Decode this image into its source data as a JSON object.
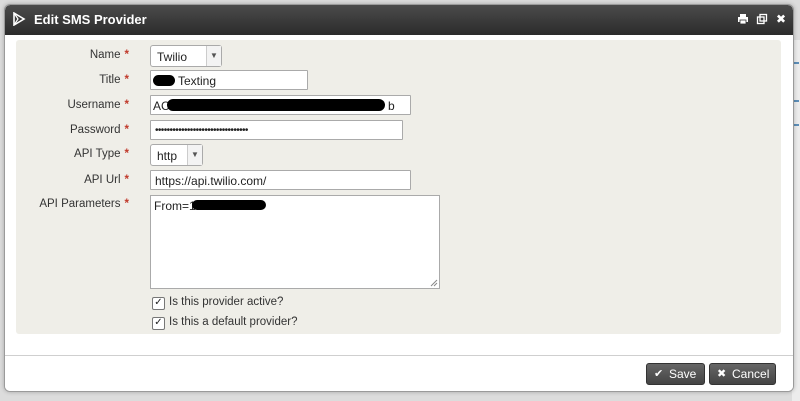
{
  "dialog": {
    "title": "Edit SMS Provider",
    "controls": {
      "print_icon": "printer-icon",
      "restore_icon": "restore-icon",
      "close_icon": "close-icon",
      "close_glyph": "✖"
    }
  },
  "form": {
    "required_mark": "*",
    "name": {
      "label": "Name",
      "value": "Twilio"
    },
    "title_field": {
      "label": "Title",
      "value": "Texting"
    },
    "username": {
      "label": "Username",
      "value_prefix": "AC",
      "value_suffix": "b"
    },
    "password": {
      "label": "Password",
      "value": "••••••••••••••••••••••••••••••••"
    },
    "api_type": {
      "label": "API Type",
      "value": "http"
    },
    "api_url": {
      "label": "API Url",
      "value": "https://api.twilio.com/"
    },
    "api_parameters": {
      "label": "API Parameters",
      "value_prefix": "From=1"
    },
    "active": {
      "label": "Is this provider active?",
      "checked": true
    },
    "default": {
      "label": "Is this a default provider?",
      "checked": true
    }
  },
  "footer": {
    "save_label": "Save",
    "cancel_label": "Cancel"
  },
  "colors": {
    "titlebar": "#333333",
    "content_bg": "#efeee8",
    "required": "#c0392b",
    "button": "#555555"
  }
}
